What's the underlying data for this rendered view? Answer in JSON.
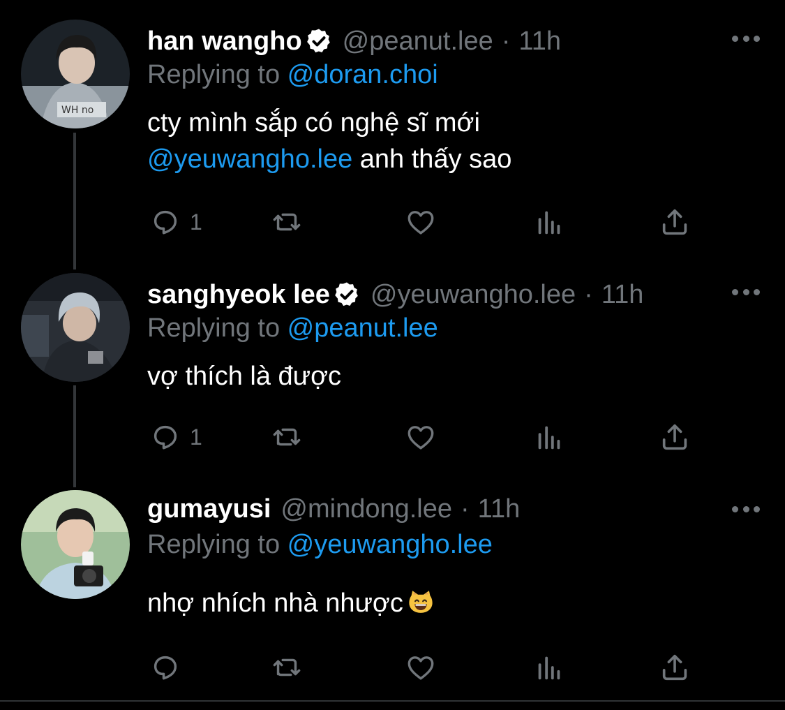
{
  "colors": {
    "background": "#000000",
    "text": "#ffffff",
    "muted": "#71767b",
    "link": "#1d9bf0"
  },
  "tweets": [
    {
      "name": "han wangho",
      "verified": true,
      "handle": "@peanut.lee",
      "separator": "·",
      "time": "11h",
      "replying_label": "Replying to ",
      "replying_to": "@doran.choi",
      "text_line1": "cty mình sắp có nghệ sĩ mới",
      "text_mention": "@yeuwangho.lee",
      "text_rest": " anh thấy sao",
      "reply_count": "1",
      "icons": {
        "reply": "reply-icon",
        "retweet": "retweet-icon",
        "like": "heart-icon",
        "views": "views-icon",
        "share": "share-icon",
        "more": "more-icon"
      }
    },
    {
      "name": "sanghyeok lee",
      "verified": true,
      "handle": "@yeuwangho.lee",
      "separator": "·",
      "time": "11h",
      "replying_label": "Replying to ",
      "replying_to": "@peanut.lee",
      "text": "vợ thích là được",
      "reply_count": "1"
    },
    {
      "name": "gumayusi",
      "verified": false,
      "handle": "@mindong.lee",
      "separator": "·",
      "time": "11h",
      "replying_label": "Replying to ",
      "replying_to": "@yeuwangho.lee",
      "text": "nhợ nhích nhà nhược",
      "emoji": "grinning-cat-emoji",
      "reply_count": ""
    }
  ]
}
